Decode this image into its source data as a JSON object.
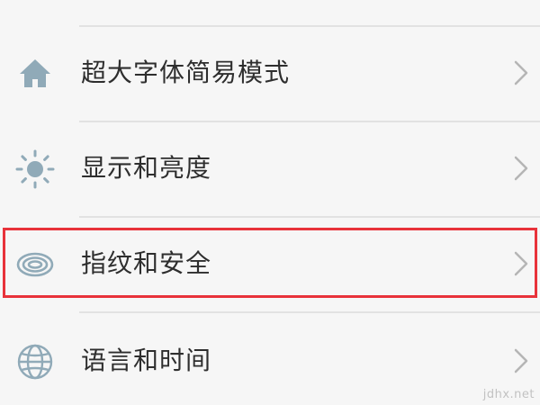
{
  "settings": {
    "items": [
      {
        "label": "超大字体简易模式",
        "icon": "home-icon"
      },
      {
        "label": "显示和亮度",
        "icon": "brightness-icon"
      },
      {
        "label": "指纹和安全",
        "icon": "fingerprint-icon",
        "highlighted": true
      },
      {
        "label": "语言和时间",
        "icon": "globe-icon"
      }
    ]
  },
  "colors": {
    "icon": "#90aab8",
    "highlight_border": "#e8323a",
    "chevron": "#b5b5b5",
    "divider": "#e2e2e2"
  },
  "watermark": "jdhx.net"
}
